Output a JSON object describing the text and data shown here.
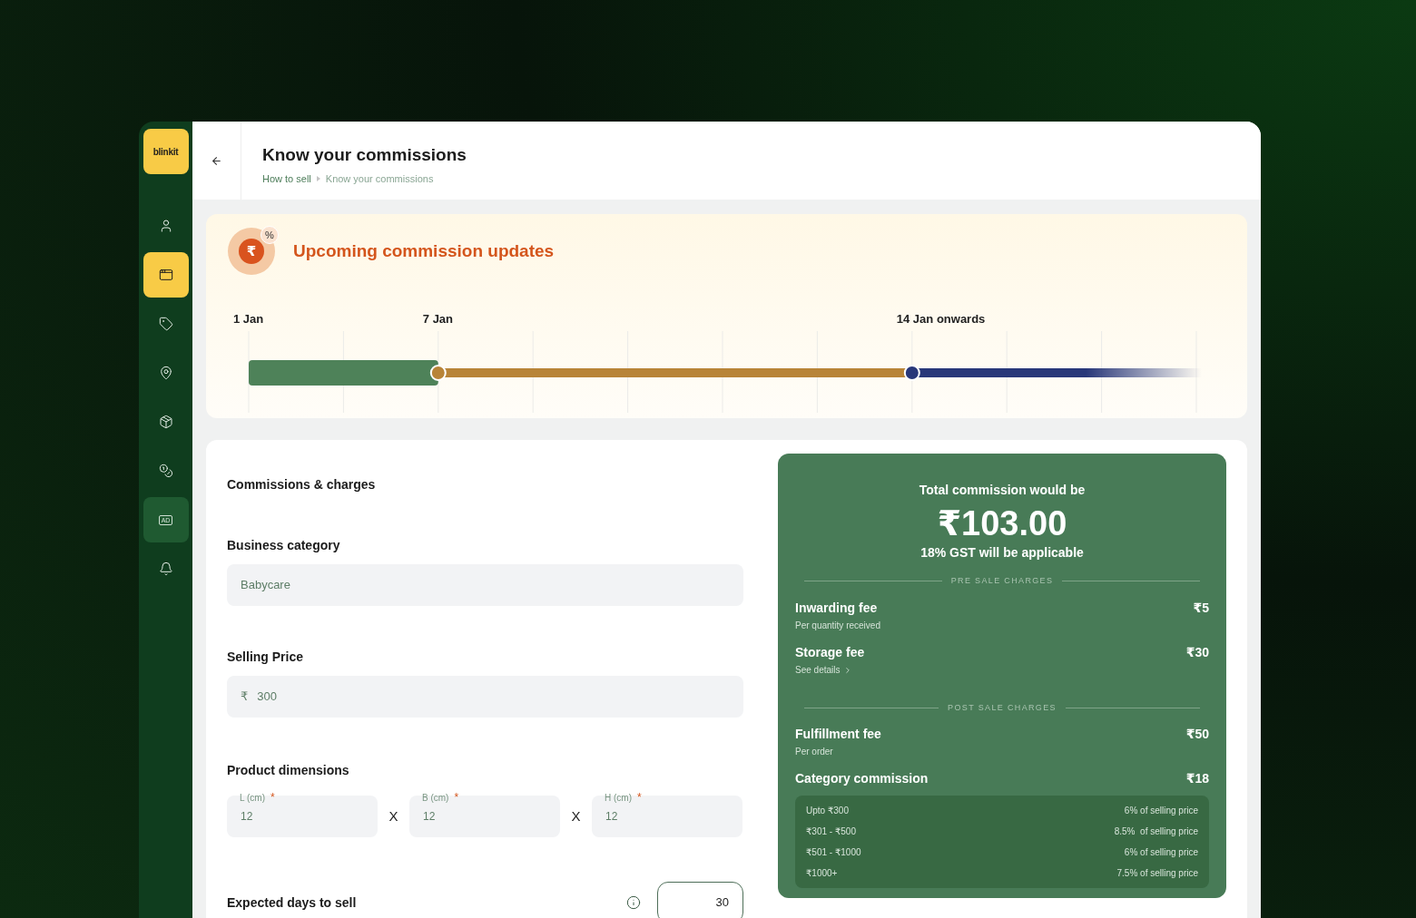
{
  "logo": {
    "text": "blinkit"
  },
  "sidebar": {
    "items": [
      {
        "kind": "user",
        "selected": false,
        "highlighted": false
      },
      {
        "kind": "window",
        "selected": true,
        "highlighted": false
      },
      {
        "kind": "tag",
        "selected": false,
        "highlighted": false
      },
      {
        "kind": "pin",
        "selected": false,
        "highlighted": false
      },
      {
        "kind": "package",
        "selected": false,
        "highlighted": false
      },
      {
        "kind": "coins",
        "selected": false,
        "highlighted": false
      },
      {
        "kind": "badge",
        "label": "AD",
        "selected": false,
        "highlighted": true
      },
      {
        "kind": "bell",
        "selected": false,
        "highlighted": false
      }
    ]
  },
  "header": {
    "title": "Know your commissions",
    "breadcrumbs": [
      "How to sell",
      "Know your commissions"
    ]
  },
  "updates": {
    "title": "Upcoming commission updates",
    "icon_symbol": "₹",
    "icon_corner": "%",
    "milestones": [
      {
        "label": "1 Jan",
        "color": "#4e8259"
      },
      {
        "label": "7 Jan",
        "color": "#b88438"
      },
      {
        "label": "14 Jan onwards",
        "color": "#283779"
      }
    ]
  },
  "form": {
    "title": "Commissions & charges",
    "fields": [
      {
        "label": "Business category",
        "value": "Babycare"
      },
      {
        "label": "Selling Price",
        "prefix": "₹",
        "value": "300"
      }
    ],
    "dimensions": {
      "label": "Product dimensions",
      "fields": [
        {
          "label": "L (cm)",
          "value": "12",
          "required_mark": "*"
        },
        {
          "separator": "X",
          "label": "B (cm)",
          "value": "12",
          "required_mark": "*"
        },
        {
          "separator": "X",
          "label": "H (cm)",
          "value": "12",
          "required_mark": "*"
        }
      ]
    },
    "days": {
      "label": "Expected days to sell",
      "value": "30"
    }
  },
  "summary": {
    "heading": "Total commission would be",
    "total": "₹103.00",
    "note": "18% GST will be applicable",
    "sections": [
      {
        "title": "PRE SALE CHARGES",
        "items": [
          {
            "name": "Inwarding fee",
            "amount": "₹5",
            "sub": "Per quantity received",
            "kind": "note"
          },
          {
            "name": "Storage fee",
            "amount": "₹30",
            "sub": "See details",
            "kind": "link"
          }
        ]
      },
      {
        "title": "POST SALE CHARGES",
        "items": [
          {
            "name": "Fulfillment fee",
            "amount": "₹50",
            "sub": "Per order",
            "kind": "note"
          },
          {
            "name": "Category commission",
            "amount": "₹18",
            "kind": "slabs",
            "slabs": [
              {
                "range": "Upto ₹300",
                "rate": "6% of selling price"
              },
              {
                "range": "₹301 - ₹500",
                "rate": "8.5%  of selling price"
              },
              {
                "range": "₹501 - ₹1000",
                "rate": "6% of selling price"
              },
              {
                "range": "₹1000+",
                "rate": "7.5% of selling price"
              }
            ]
          }
        ]
      }
    ]
  }
}
